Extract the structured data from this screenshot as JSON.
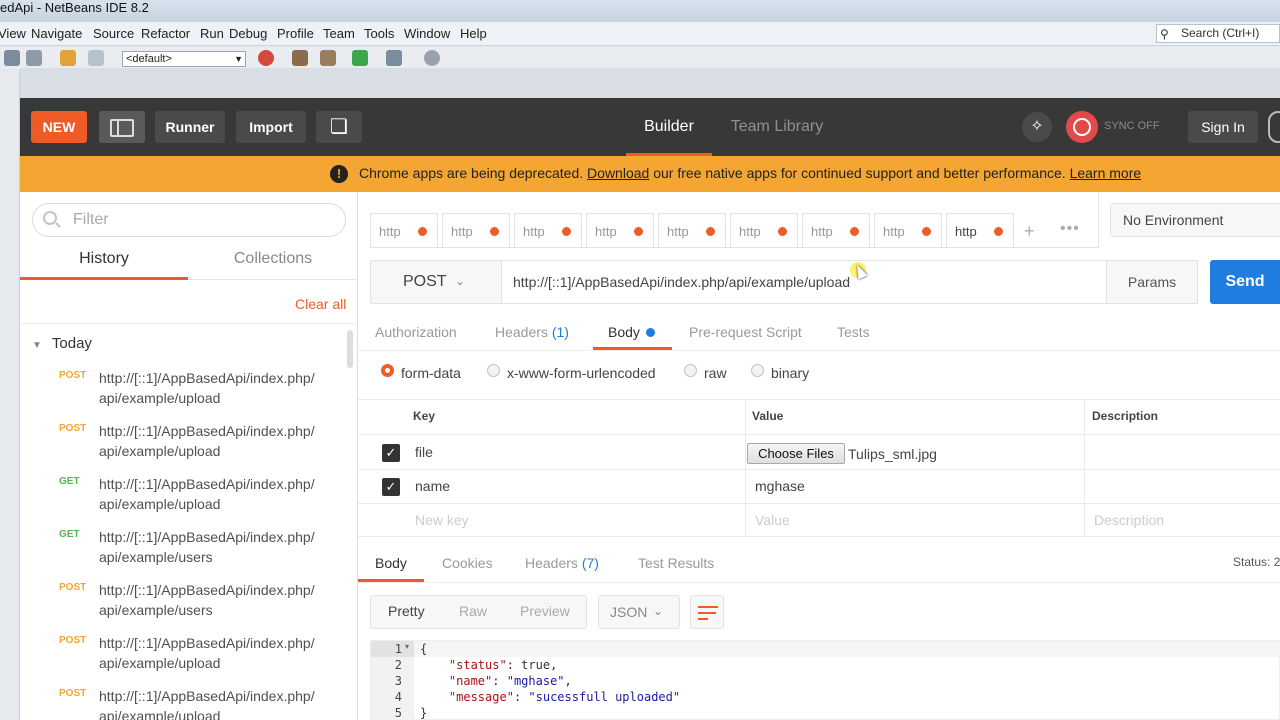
{
  "netbeans": {
    "title": "edApi - NetBeans IDE 8.2",
    "menus": [
      "View",
      "Navigate",
      "Source",
      "Refactor",
      "Run",
      "Debug",
      "Profile",
      "Team",
      "Tools",
      "Window",
      "Help"
    ],
    "search_placeholder": "Search (Ctrl+I)",
    "config_value": "<default>"
  },
  "header": {
    "new_label": "NEW",
    "runner_label": "Runner",
    "import_label": "Import",
    "tabs": [
      "Builder",
      "Team Library"
    ],
    "active_tab": "Builder",
    "sync_label": "SYNC OFF",
    "signin_label": "Sign In"
  },
  "banner": {
    "text_before": "Chrome apps are being deprecated. ",
    "link_download": "Download",
    "text_after": " our free native apps for continued support and better performance. ",
    "link_learn": "Learn more",
    "color": "#f4a532"
  },
  "sidebar": {
    "filter_placeholder": "Filter",
    "tabs": [
      "History",
      "Collections"
    ],
    "clear_all": "Clear all",
    "group_label": "Today",
    "history": [
      {
        "method": "POST",
        "url": "http://[::1]/AppBasedApi/index.php/api/example/upload"
      },
      {
        "method": "POST",
        "url": "http://[::1]/AppBasedApi/index.php/api/example/upload"
      },
      {
        "method": "GET",
        "url": "http://[::1]/AppBasedApi/index.php/api/example/upload"
      },
      {
        "method": "GET",
        "url": "http://[::1]/AppBasedApi/index.php/api/example/users"
      },
      {
        "method": "POST",
        "url": "http://[::1]/AppBasedApi/index.php/api/example/users"
      },
      {
        "method": "POST",
        "url": "http://[::1]/AppBasedApi/index.php/api/example/upload"
      },
      {
        "method": "POST",
        "url": "http://[::1]/AppBasedApi/index.php/api/example/upload"
      }
    ]
  },
  "request_tabs": [
    "http",
    "http",
    "http",
    "http",
    "http",
    "http",
    "http",
    "http",
    "http"
  ],
  "environment": "No Environment",
  "request": {
    "method": "POST",
    "url": "http://[::1]/AppBasedApi/index.php/api/example/upload",
    "params_label": "Params",
    "send_label": "Send",
    "subtabs": {
      "authorization": "Authorization",
      "headers": "Headers",
      "headers_count": "(1)",
      "body": "Body",
      "prerequest": "Pre-request Script",
      "tests": "Tests"
    },
    "body_modes": [
      "form-data",
      "x-www-form-urlencoded",
      "raw",
      "binary"
    ],
    "selected_mode": "form-data",
    "columns": {
      "key": "Key",
      "value": "Value",
      "description": "Description"
    },
    "rows": [
      {
        "key": "file",
        "value": "Tulips_sml.jpg",
        "checked": true,
        "type": "file"
      },
      {
        "key": "name",
        "value": "mghase",
        "checked": true,
        "type": "text"
      }
    ],
    "choose_files_label": "Choose Files",
    "new_key_placeholder": "New key",
    "value_placeholder": "Value",
    "description_placeholder": "Description"
  },
  "response": {
    "tabs": {
      "body": "Body",
      "cookies": "Cookies",
      "headers": "Headers",
      "headers_count": "(7)",
      "test_results": "Test Results"
    },
    "status_label": "Status: 2",
    "views": [
      "Pretty",
      "Raw",
      "Preview"
    ],
    "format": "JSON",
    "line_numbers": [
      "1",
      "2",
      "3",
      "4",
      "5"
    ],
    "json": {
      "status": "true",
      "name": "\"mghase\"",
      "message": "\"sucessfull uploaded\""
    }
  }
}
